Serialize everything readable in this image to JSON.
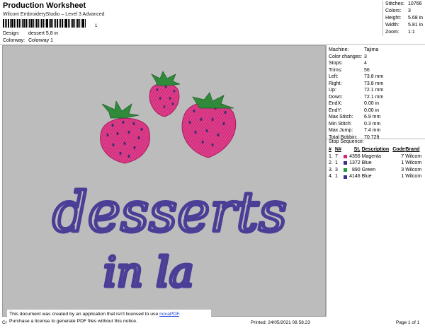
{
  "header": {
    "title": "Production Worksheet",
    "subtitle": "Wilcom EmbroideryStudio – Level 3 Advanced",
    "barcode_suffix": "1",
    "design_label": "Design:",
    "design_value": "dessert 5,8 in",
    "colorway_label": "Colorway:",
    "colorway_value": "Colorway 1"
  },
  "stats": [
    {
      "label": "Stitches:",
      "value": "10766"
    },
    {
      "label": "Colors:",
      "value": "3"
    },
    {
      "label": "Height:",
      "value": "5.68 in"
    },
    {
      "label": "Width:",
      "value": "5.81 in"
    },
    {
      "label": "Zoom:",
      "value": "1:1"
    }
  ],
  "design": {
    "text_line1": "desserts",
    "text_line2": "in la",
    "thread_fill": "#d4307f",
    "thread_text": "#4a3e96",
    "leaf_color": "#2f8a3a"
  },
  "machine": [
    {
      "label": "Machine:",
      "value": "Tajima"
    },
    {
      "label": "Color changes:",
      "value": "3"
    },
    {
      "label": "Stops:",
      "value": "4"
    },
    {
      "label": "Trims:",
      "value": "56"
    },
    {
      "label": "Left:",
      "value": "73.8 mm"
    },
    {
      "label": "Right:",
      "value": "73.8 mm"
    },
    {
      "label": "Up:",
      "value": "72.1 mm"
    },
    {
      "label": "Down:",
      "value": "72.1 mm"
    },
    {
      "label": "EndX:",
      "value": "0.00 in"
    },
    {
      "label": "EndY:",
      "value": "0.00 in"
    },
    {
      "label": "Max Stitch:",
      "value": "6.9 mm"
    },
    {
      "label": "Min Stitch:",
      "value": "0.3 mm"
    },
    {
      "label": "Max Jump:",
      "value": "7.4 mm"
    },
    {
      "label": "Total Bobbin:",
      "value": "70.72ft"
    }
  ],
  "stop_sequence": {
    "title": "Stop Sequence:",
    "headers": [
      "#",
      "N#",
      "St.",
      "Description",
      "Code",
      "Brand"
    ],
    "rows": [
      {
        "num": "1.",
        "n": "7",
        "color": "#d6247e",
        "st": "4356",
        "desc": "Magenta",
        "code": "7",
        "brand": "Wilcom"
      },
      {
        "num": "2.",
        "n": "1",
        "color": "#3a2f8c",
        "st": "1372",
        "desc": "Blue",
        "code": "1",
        "brand": "Wilcom"
      },
      {
        "num": "3.",
        "n": "3",
        "color": "#1f9a3a",
        "st": "890",
        "desc": "Green",
        "code": "3",
        "brand": "Wilcom"
      },
      {
        "num": "4.",
        "n": "1",
        "color": "#3a2f8c",
        "st": "4146",
        "desc": "Blue",
        "code": "1",
        "brand": "Wilcom"
      }
    ]
  },
  "footer": {
    "left": "Cr",
    "printed": "Printed: 24/05/2021 08.58.23",
    "page": "Page 1 of 1",
    "notice_line1": "This document was created by an application that isn't licensed to use ",
    "notice_link": "novaPDF",
    "notice_line2": "Purchase a license to generate PDF files without this notice."
  }
}
